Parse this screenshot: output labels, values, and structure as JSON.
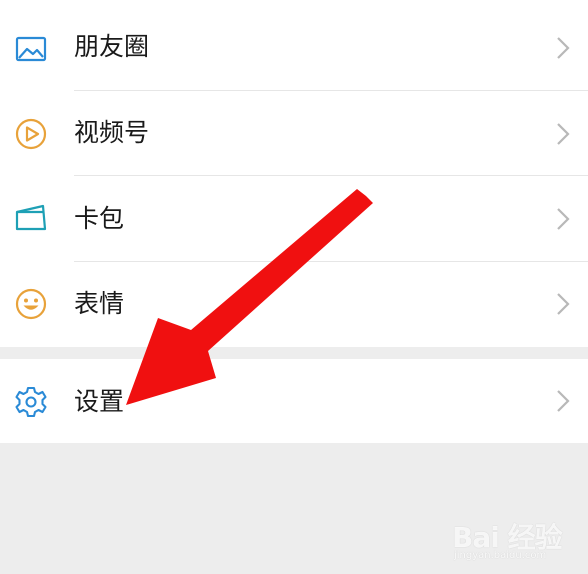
{
  "menu": {
    "items": [
      {
        "label": "朋友圈",
        "icon": "moments-icon",
        "icon_color": "#2a8ad6"
      },
      {
        "label": "视频号",
        "icon": "channels-play-icon",
        "icon_color": "#e8a23a"
      },
      {
        "label": "卡包",
        "icon": "card-wallet-icon",
        "icon_color": "#1ea0b5"
      },
      {
        "label": "表情",
        "icon": "sticker-smile-icon",
        "icon_color": "#e8a23a"
      }
    ],
    "settings": {
      "label": "设置",
      "icon": "gear-icon",
      "icon_color": "#2a8ad6"
    }
  },
  "annotation": {
    "arrow_color": "#f01010"
  },
  "watermark": {
    "text": "Bai 经验",
    "sub": "jingyan.baidu.com"
  }
}
